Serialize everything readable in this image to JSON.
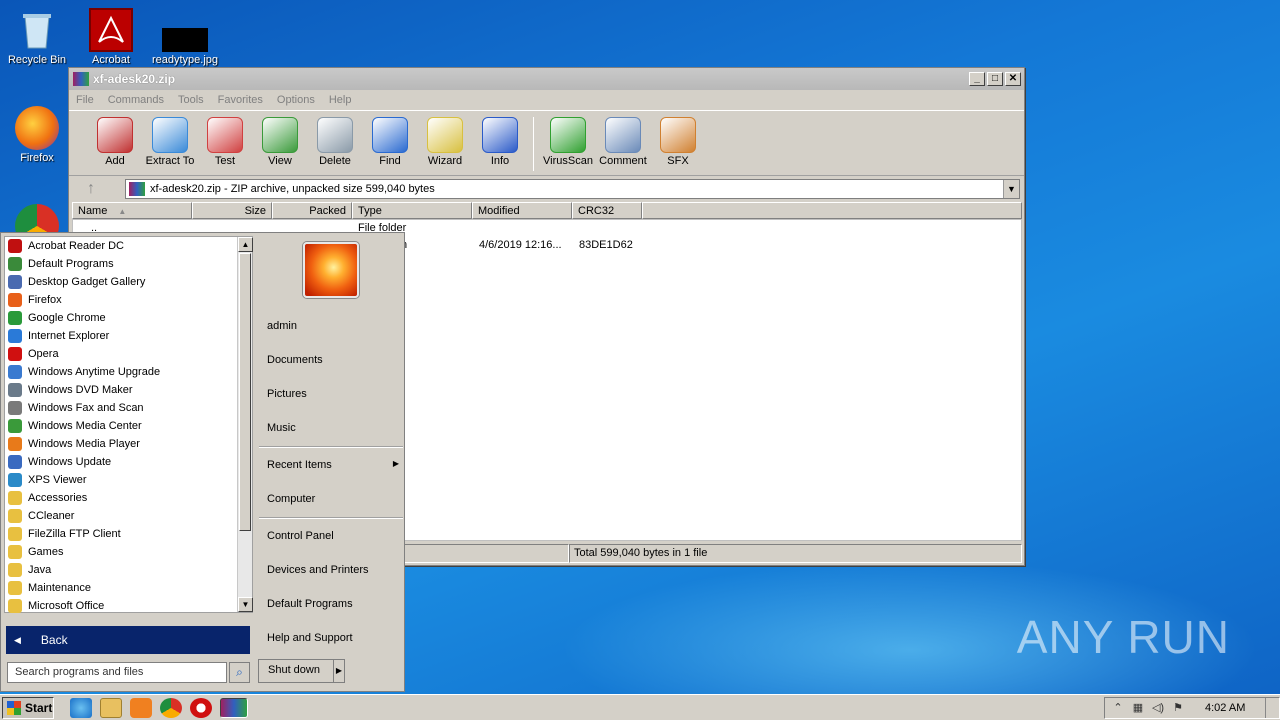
{
  "desktop": {
    "icons": [
      {
        "label": "Recycle Bin"
      },
      {
        "label": "Acrobat"
      },
      {
        "label": "readytype.jpg"
      },
      {
        "label": "Firefox"
      }
    ],
    "watermark": "ANY RUN"
  },
  "winrar": {
    "title": "xf-adesk20.zip",
    "menu": [
      "File",
      "Commands",
      "Tools",
      "Favorites",
      "Options",
      "Help"
    ],
    "toolbar": [
      {
        "label": "Add",
        "color": "#c03030"
      },
      {
        "label": "Extract To",
        "color": "#3a8ad8"
      },
      {
        "label": "Test",
        "color": "#d04040"
      },
      {
        "label": "View",
        "color": "#3a9a3a"
      },
      {
        "label": "Delete",
        "color": "#8a9aa8"
      },
      {
        "label": "Find",
        "color": "#2a6ad0"
      },
      {
        "label": "Wizard",
        "color": "#d8c040"
      },
      {
        "label": "Info",
        "color": "#2a5ac8"
      },
      {
        "label": "VirusScan",
        "color": "#30a030"
      },
      {
        "label": "Comment",
        "color": "#6a8ab8"
      },
      {
        "label": "SFX",
        "color": "#d08030"
      }
    ],
    "address": "xf-adesk20.zip - ZIP archive, unpacked size 599,040 bytes",
    "columns": [
      "Name",
      "Size",
      "Packed",
      "Type",
      "Modified",
      "CRC32"
    ],
    "rows": [
      {
        "name": "..",
        "size": "",
        "packed": "",
        "type": "File folder",
        "modified": "",
        "crc": ""
      },
      {
        "name": "",
        "size": "",
        "packed": "",
        "type": "n",
        "modified": "4/6/2019 12:16...",
        "crc": "83DE1D62"
      }
    ],
    "status_right": "Total 599,040 bytes in 1 file"
  },
  "start_menu": {
    "programs": [
      {
        "label": "Acrobat Reader DC",
        "color": "#c01010"
      },
      {
        "label": "Default Programs",
        "color": "#3a8a3a"
      },
      {
        "label": "Desktop Gadget Gallery",
        "color": "#4a6ab0"
      },
      {
        "label": "Firefox",
        "color": "#e8601a"
      },
      {
        "label": "Google Chrome",
        "color": "#2a9a3a"
      },
      {
        "label": "Internet Explorer",
        "color": "#2a7ad8"
      },
      {
        "label": "Opera",
        "color": "#d01010"
      },
      {
        "label": "Windows Anytime Upgrade",
        "color": "#3a7ad0"
      },
      {
        "label": "Windows DVD Maker",
        "color": "#6a7a8a"
      },
      {
        "label": "Windows Fax and Scan",
        "color": "#7a7a7a"
      },
      {
        "label": "Windows Media Center",
        "color": "#3a9a3a"
      },
      {
        "label": "Windows Media Player",
        "color": "#e87a1a"
      },
      {
        "label": "Windows Update",
        "color": "#3a6ac0"
      },
      {
        "label": "XPS Viewer",
        "color": "#2a8ac8"
      },
      {
        "label": "Accessories",
        "color": "#e8c040"
      },
      {
        "label": "CCleaner",
        "color": "#e8c040"
      },
      {
        "label": "FileZilla FTP Client",
        "color": "#e8c040"
      },
      {
        "label": "Games",
        "color": "#e8c040"
      },
      {
        "label": "Java",
        "color": "#e8c040"
      },
      {
        "label": "Maintenance",
        "color": "#e8c040"
      },
      {
        "label": "Microsoft Office",
        "color": "#e8c040"
      }
    ],
    "back_label": "Back",
    "search_placeholder": "Search programs and files",
    "user": "admin",
    "right_items": [
      "Documents",
      "Pictures",
      "Music",
      "Recent Items",
      "Computer",
      "Control Panel",
      "Devices and Printers",
      "Default Programs",
      "Help and Support"
    ],
    "shutdown_label": "Shut down"
  },
  "taskbar": {
    "start_label": "Start",
    "clock": "4:02 AM"
  }
}
